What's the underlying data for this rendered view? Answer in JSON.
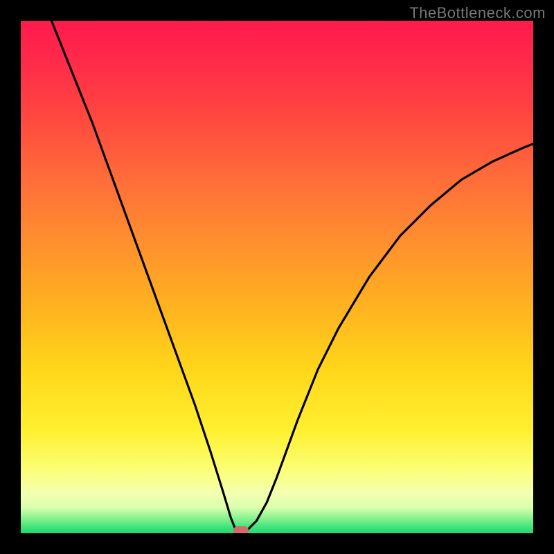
{
  "watermark": "TheBottleneck.com",
  "chart_data": {
    "type": "line",
    "title": "",
    "xlabel": "",
    "ylabel": "",
    "xlim": [
      0,
      1
    ],
    "ylim": [
      0,
      1
    ],
    "gradient_stops": [
      {
        "pct": 0,
        "color": "#ff1a4d"
      },
      {
        "pct": 8,
        "color": "#ff2a4a"
      },
      {
        "pct": 18,
        "color": "#ff4540"
      },
      {
        "pct": 30,
        "color": "#ff6a3a"
      },
      {
        "pct": 42,
        "color": "#ff8c30"
      },
      {
        "pct": 55,
        "color": "#ffb020"
      },
      {
        "pct": 68,
        "color": "#ffd61a"
      },
      {
        "pct": 80,
        "color": "#fff030"
      },
      {
        "pct": 88,
        "color": "#fbff7a"
      },
      {
        "pct": 92,
        "color": "#f6ffb0"
      },
      {
        "pct": 95,
        "color": "#d9ffae"
      },
      {
        "pct": 97,
        "color": "#8cf28f"
      },
      {
        "pct": 99,
        "color": "#38e27a"
      },
      {
        "pct": 100,
        "color": "#20d96e"
      }
    ],
    "series": [
      {
        "name": "bottleneck-curve",
        "x": [
          0.06,
          0.1,
          0.14,
          0.18,
          0.22,
          0.26,
          0.3,
          0.34,
          0.37,
          0.395,
          0.41,
          0.418,
          0.424,
          0.43,
          0.44,
          0.46,
          0.48,
          0.5,
          0.54,
          0.58,
          0.62,
          0.68,
          0.74,
          0.8,
          0.86,
          0.92,
          0.98,
          1.0
        ],
        "y": [
          1.0,
          0.9,
          0.8,
          0.69,
          0.58,
          0.47,
          0.36,
          0.25,
          0.16,
          0.08,
          0.03,
          0.01,
          0.003,
          0.003,
          0.004,
          0.024,
          0.06,
          0.11,
          0.22,
          0.32,
          0.4,
          0.5,
          0.58,
          0.64,
          0.69,
          0.725,
          0.752,
          0.76
        ]
      }
    ],
    "marker": {
      "x": 0.43,
      "y": 0.005,
      "color": "#d36a6a"
    }
  }
}
